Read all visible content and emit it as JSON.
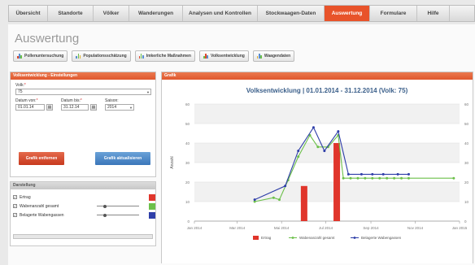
{
  "nav": {
    "tabs": [
      {
        "label": "Übersicht"
      },
      {
        "label": "Standorte"
      },
      {
        "label": "Völker"
      },
      {
        "label": "Wanderungen"
      },
      {
        "label": "Analysen und Kontrollen"
      },
      {
        "label": "Stockwaagen-Daten"
      },
      {
        "label": "Auswertung",
        "active": true
      },
      {
        "label": "Formulare"
      },
      {
        "label": "Hilfe"
      }
    ]
  },
  "page": {
    "title": "Auswertung"
  },
  "toolbar": {
    "buttons": [
      {
        "label": "Pollenuntersuchung"
      },
      {
        "label": "Populationsschätzung"
      },
      {
        "label": "Imkerliche Maßnahmen"
      },
      {
        "label": "Volksentwicklung"
      },
      {
        "label": "Waagendaten"
      }
    ]
  },
  "settings": {
    "header": "Volksentwicklung - Einstellungen",
    "volk_label": "Volk:",
    "volk_value": "75",
    "from_label": "Datum von:",
    "from_value": "01.01.14",
    "to_label": "Datum bis:",
    "to_value": "31.12.14",
    "season_label": "Saison:",
    "season_value": "2014",
    "remove_button": "Grafik entfernen",
    "update_button": "Grafik aktualisieren"
  },
  "display": {
    "header": "Darstellung",
    "items": [
      {
        "label": "Ertrag",
        "checked": true,
        "color": "#e0352b",
        "slider": false
      },
      {
        "label": "Wabenanzahl gesamt",
        "checked": true,
        "color": "#6cc04a",
        "slider": true,
        "level": 0.2
      },
      {
        "label": "Belagerte Wabengassen",
        "checked": true,
        "color": "#2e3ea8",
        "slider": true,
        "level": 0.2
      }
    ]
  },
  "graph": {
    "header": "Grafik"
  },
  "chart_data": {
    "type": "line",
    "title": "Volksentwicklung | 01.01.2014 - 31.12.2014 (Volk: 75)",
    "ylabel": "Anzahl",
    "xlabel": "",
    "ylim": [
      0,
      60
    ],
    "yticks": [
      0,
      10,
      20,
      30,
      40,
      50,
      60
    ],
    "x_tick_labels": [
      "Jan 2014",
      "Mar 2014",
      "Mai 2014",
      "Jul 2014",
      "Sep 2014",
      "Nov 2014",
      "Jan 2015"
    ],
    "grid": true,
    "legend_position": "bottom",
    "series": [
      {
        "name": "Ertrag",
        "kind": "bar",
        "color": "#e0352b",
        "points": [
          {
            "x": "2014-06-01",
            "y": 18
          },
          {
            "x": "2014-07-16",
            "y": 40
          }
        ]
      },
      {
        "name": "Wabenanzahl gesamt",
        "kind": "line",
        "color": "#6cc04a",
        "points": [
          {
            "x": "2014-03-25",
            "y": 10
          },
          {
            "x": "2014-04-20",
            "y": 12
          },
          {
            "x": "2014-04-28",
            "y": 11
          },
          {
            "x": "2014-05-10",
            "y": 21
          },
          {
            "x": "2014-05-24",
            "y": 33
          },
          {
            "x": "2014-06-09",
            "y": 44
          },
          {
            "x": "2014-06-20",
            "y": 38
          },
          {
            "x": "2014-07-04",
            "y": 38
          },
          {
            "x": "2014-07-18",
            "y": 44
          },
          {
            "x": "2014-07-25",
            "y": 22
          },
          {
            "x": "2014-08-04",
            "y": 22
          },
          {
            "x": "2014-08-14",
            "y": 22
          },
          {
            "x": "2014-08-24",
            "y": 22
          },
          {
            "x": "2014-09-03",
            "y": 22
          },
          {
            "x": "2014-09-13",
            "y": 22
          },
          {
            "x": "2014-09-23",
            "y": 22
          },
          {
            "x": "2014-10-03",
            "y": 22
          },
          {
            "x": "2014-10-13",
            "y": 22
          },
          {
            "x": "2014-10-23",
            "y": 22
          },
          {
            "x": "2014-12-24",
            "y": 22
          }
        ]
      },
      {
        "name": "Belagerte Wabengassen",
        "kind": "line",
        "color": "#2e3ea8",
        "points": [
          {
            "x": "2014-03-25",
            "y": 11
          },
          {
            "x": "2014-05-06",
            "y": 18
          },
          {
            "x": "2014-05-24",
            "y": 36
          },
          {
            "x": "2014-06-14",
            "y": 48
          },
          {
            "x": "2014-06-29",
            "y": 36
          },
          {
            "x": "2014-07-18",
            "y": 46
          },
          {
            "x": "2014-08-01",
            "y": 24
          },
          {
            "x": "2014-08-19",
            "y": 24
          },
          {
            "x": "2014-09-03",
            "y": 24
          },
          {
            "x": "2014-09-18",
            "y": 24
          },
          {
            "x": "2014-10-08",
            "y": 24
          },
          {
            "x": "2014-10-23",
            "y": 24
          }
        ]
      }
    ]
  }
}
